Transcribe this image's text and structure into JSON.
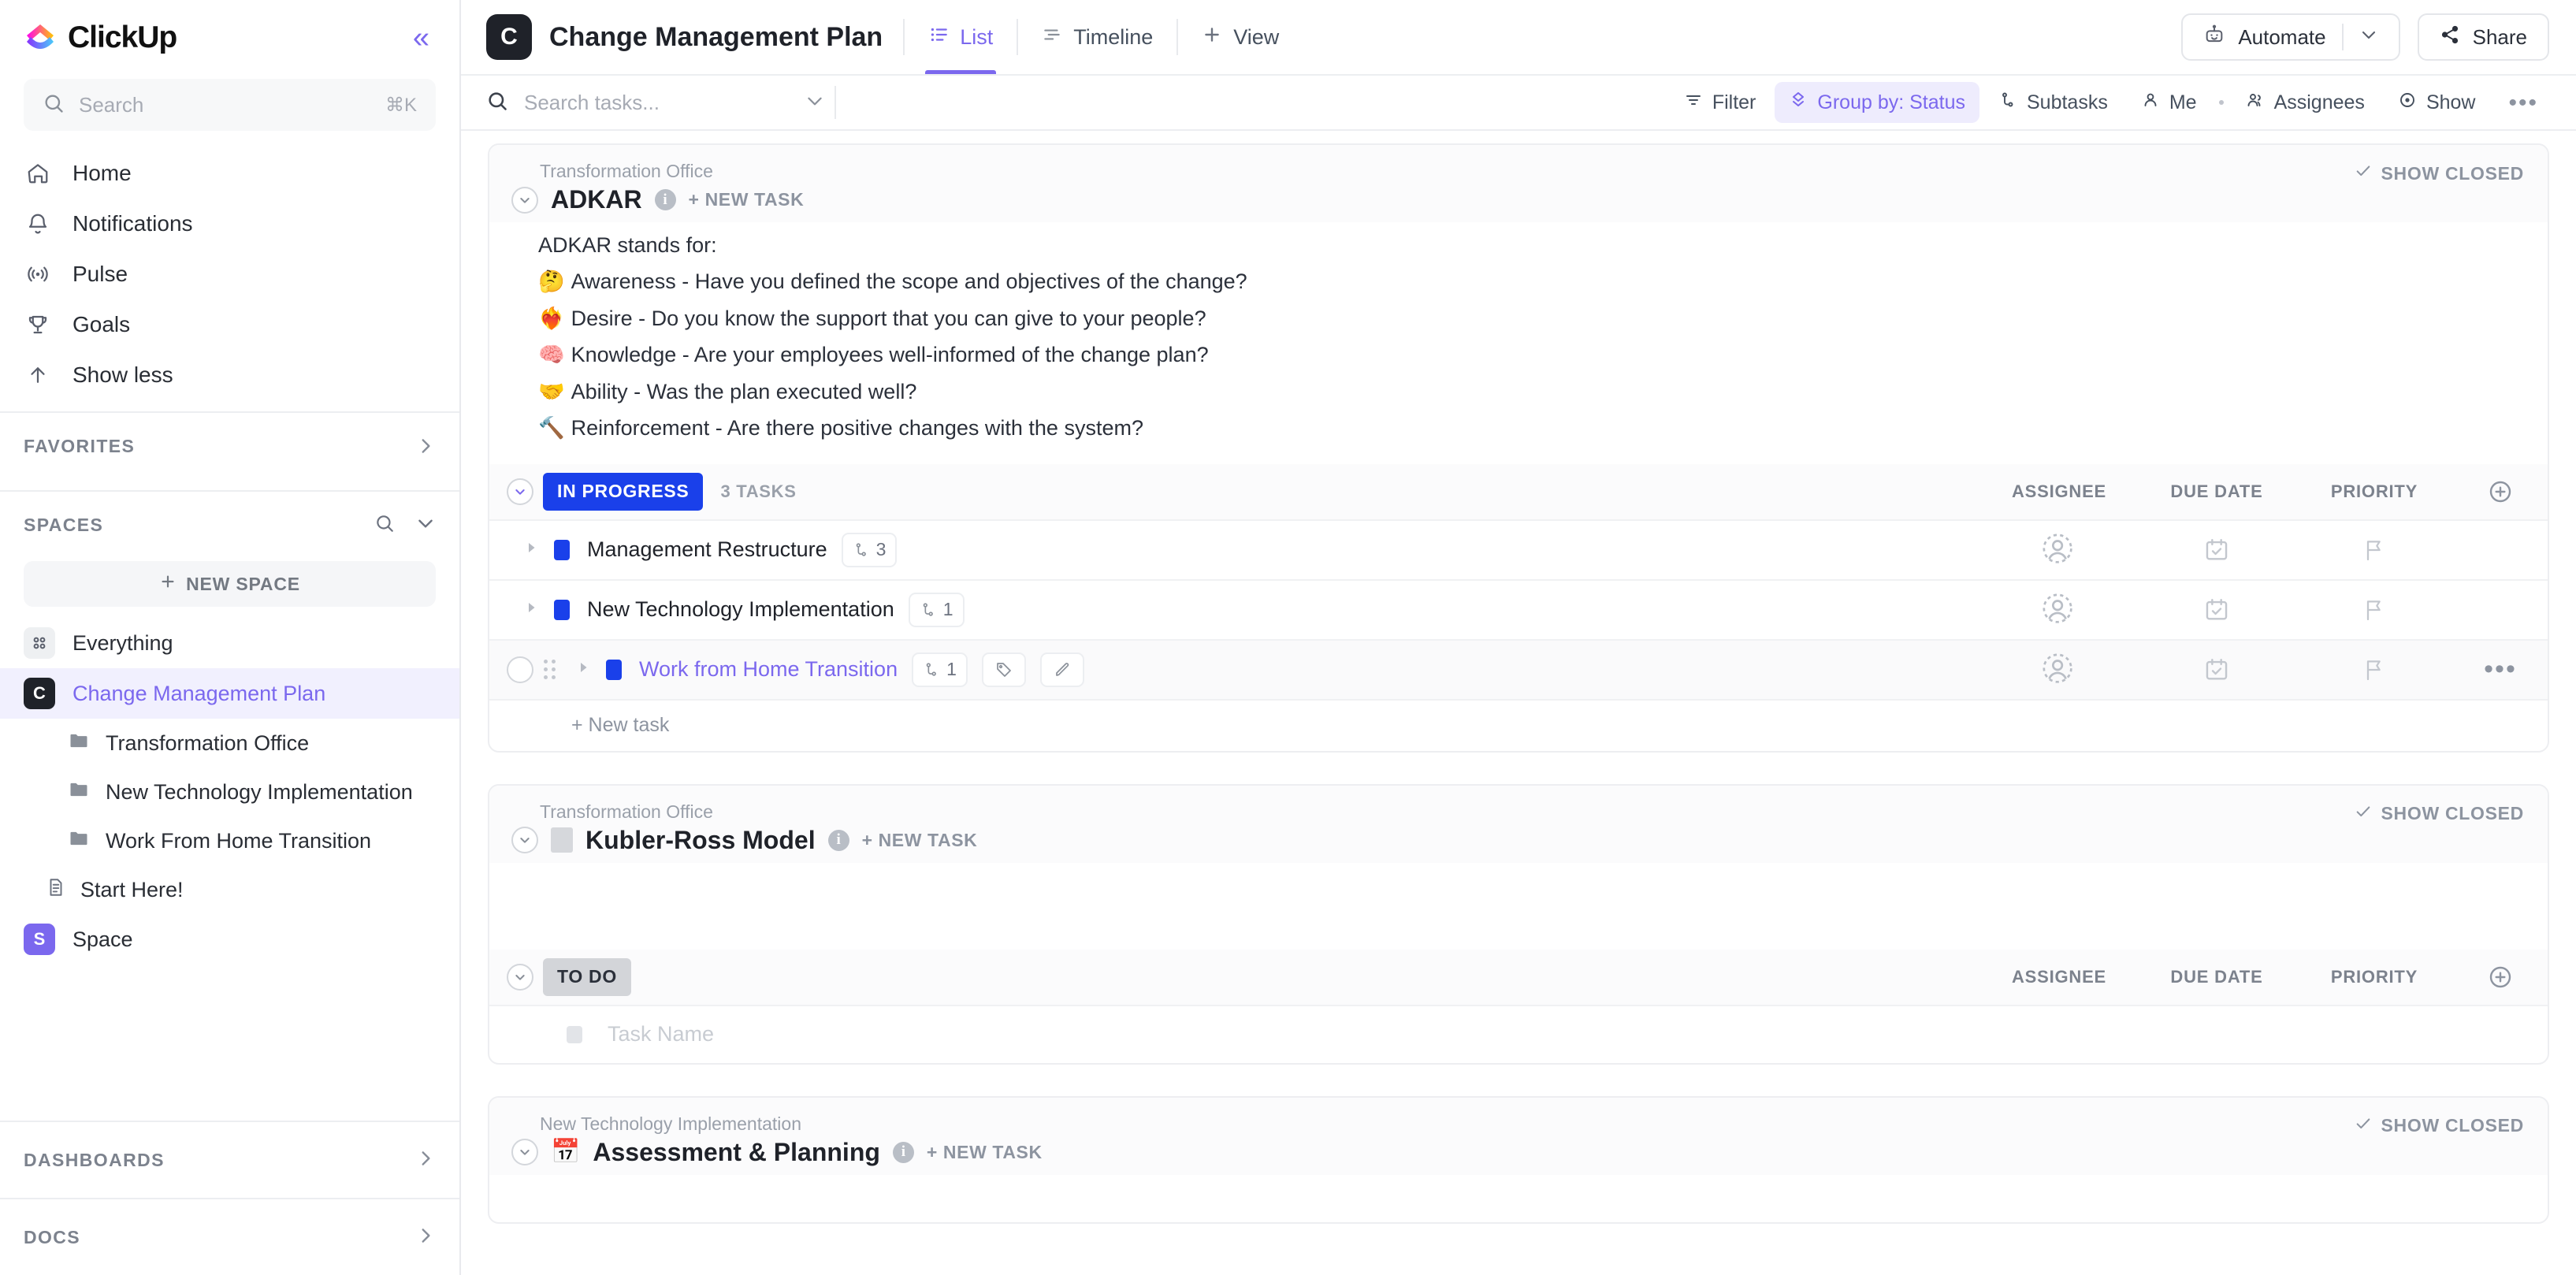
{
  "sidebar": {
    "brand": "ClickUp",
    "collapse_icon": "chevrons-left-icon",
    "search": {
      "placeholder": "Search",
      "shortcut": "⌘K"
    },
    "nav": [
      {
        "label": "Home",
        "icon": "home-icon"
      },
      {
        "label": "Notifications",
        "icon": "bell-icon"
      },
      {
        "label": "Pulse",
        "icon": "pulse-icon"
      },
      {
        "label": "Goals",
        "icon": "trophy-icon"
      },
      {
        "label": "Show less",
        "icon": "arrow-up-icon"
      }
    ],
    "favorites": {
      "label": "FAVORITES"
    },
    "spaces": {
      "label": "SPACES",
      "new_space": "NEW SPACE"
    },
    "items": [
      {
        "label": "Everything",
        "type": "everything",
        "badge": "",
        "color": "#eef0f2"
      },
      {
        "label": "Change Management Plan",
        "type": "space",
        "badge": "C",
        "color": "#1f2229",
        "active": true
      }
    ],
    "folders": [
      {
        "label": "Transformation Office"
      },
      {
        "label": "New Technology Implementation"
      },
      {
        "label": "Work From Home Transition"
      }
    ],
    "doc": {
      "label": "Start Here!"
    },
    "other_space": {
      "label": "Space",
      "badge": "S",
      "color": "#7b68ee"
    },
    "dashboards": {
      "label": "DASHBOARDS"
    },
    "docs": {
      "label": "DOCS"
    }
  },
  "header": {
    "project_badge": "C",
    "title": "Change Management Plan",
    "tabs": [
      {
        "label": "List",
        "icon": "list-icon",
        "active": true
      },
      {
        "label": "Timeline",
        "icon": "timeline-icon",
        "active": false
      },
      {
        "label": "View",
        "icon": "plus-icon",
        "active": false
      }
    ],
    "automate": "Automate",
    "share": "Share"
  },
  "toolbar": {
    "search_placeholder": "Search tasks...",
    "items": [
      {
        "label": "Filter",
        "icon": "filter-icon",
        "active": false
      },
      {
        "label": "Group by: Status",
        "icon": "group-icon",
        "active": true
      },
      {
        "label": "Subtasks",
        "icon": "subtask-icon",
        "active": false
      },
      {
        "label": "Me",
        "icon": "person-icon",
        "active": false
      },
      {
        "label": "Assignees",
        "icon": "people-icon",
        "active": false
      },
      {
        "label": "Show",
        "icon": "eye-icon",
        "active": false
      }
    ],
    "more": "•••"
  },
  "columns": {
    "assignee": "ASSIGNEE",
    "due_date": "DUE DATE",
    "priority": "PRIORITY"
  },
  "common": {
    "show_closed": "SHOW CLOSED",
    "new_task_caps": "+ NEW TASK",
    "new_task": "+ New task"
  },
  "groups": [
    {
      "breadcrumb": "Transformation Office",
      "title": "ADKAR",
      "emoji": "",
      "description_lead": "ADKAR stands for:",
      "description_lines": [
        {
          "emoji": "🤔",
          "text": "Awareness - Have you defined the scope and objectives of the change?"
        },
        {
          "emoji": "❤️‍🔥",
          "text": "Desire - Do you know the support that you can give to your people?"
        },
        {
          "emoji": "🧠",
          "text": "Knowledge - Are your employees well-informed of the change plan?"
        },
        {
          "emoji": "🤝",
          "text": "Ability - Was the plan executed well?"
        },
        {
          "emoji": "🔨",
          "text": "Reinforcement - Are there positive changes with the system?"
        }
      ],
      "status": {
        "label": "IN PROGRESS",
        "color": "#1a40ea",
        "text_color": "#ffffff",
        "count": "3 TASKS"
      },
      "tasks": [
        {
          "name": "Management Restructure",
          "subtask_count": "3",
          "hovered": false
        },
        {
          "name": "New Technology Implementation",
          "subtask_count": "1",
          "hovered": false
        },
        {
          "name": "Work from Home Transition",
          "subtask_count": "1",
          "hovered": true
        }
      ]
    },
    {
      "breadcrumb": "Transformation Office",
      "title": "Kubler-Ross Model",
      "emoji": "",
      "status": {
        "label": "TO DO",
        "color": "#d3d5d9",
        "text_color": "#2b303a"
      },
      "placeholder_task": "Task Name"
    },
    {
      "breadcrumb": "New Technology Implementation",
      "title": "Assessment & Planning",
      "emoji": "📅"
    }
  ]
}
